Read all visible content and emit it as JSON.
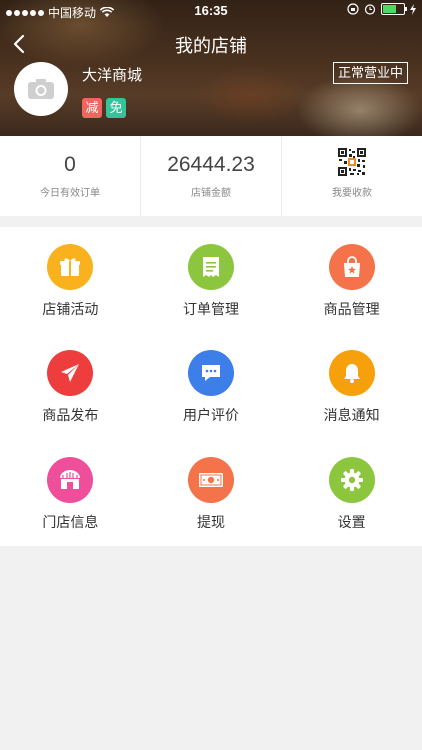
{
  "status_bar": {
    "carrier": "中国移动",
    "time": "16:35"
  },
  "nav": {
    "title": "我的店铺"
  },
  "shop": {
    "name": "大洋商城",
    "badges": [
      "减",
      "免"
    ],
    "status": "正常营业中"
  },
  "stats": [
    {
      "value": "0",
      "label": "今日有效订单"
    },
    {
      "value": "26444.23",
      "label": "店铺金额"
    },
    {
      "label": "我要收款"
    }
  ],
  "menu": [
    {
      "label": "店铺活动",
      "icon": "gift-icon",
      "color": "#f9b21e"
    },
    {
      "label": "订单管理",
      "icon": "receipt-icon",
      "color": "#8cc63f"
    },
    {
      "label": "商品管理",
      "icon": "shopping-bag-icon",
      "color": "#f5734a"
    },
    {
      "label": "商品发布",
      "icon": "paper-plane-icon",
      "color": "#ee3d3d"
    },
    {
      "label": "用户评价",
      "icon": "chat-bubble-icon",
      "color": "#3d7ee8"
    },
    {
      "label": "消息通知",
      "icon": "bell-icon",
      "color": "#f6a10c"
    },
    {
      "label": "门店信息",
      "icon": "storefront-icon",
      "color": "#ee4e9a"
    },
    {
      "label": "提现",
      "icon": "banknote-icon",
      "color": "#f5734a"
    },
    {
      "label": "设置",
      "icon": "gear-icon",
      "color": "#8cc63f"
    }
  ]
}
